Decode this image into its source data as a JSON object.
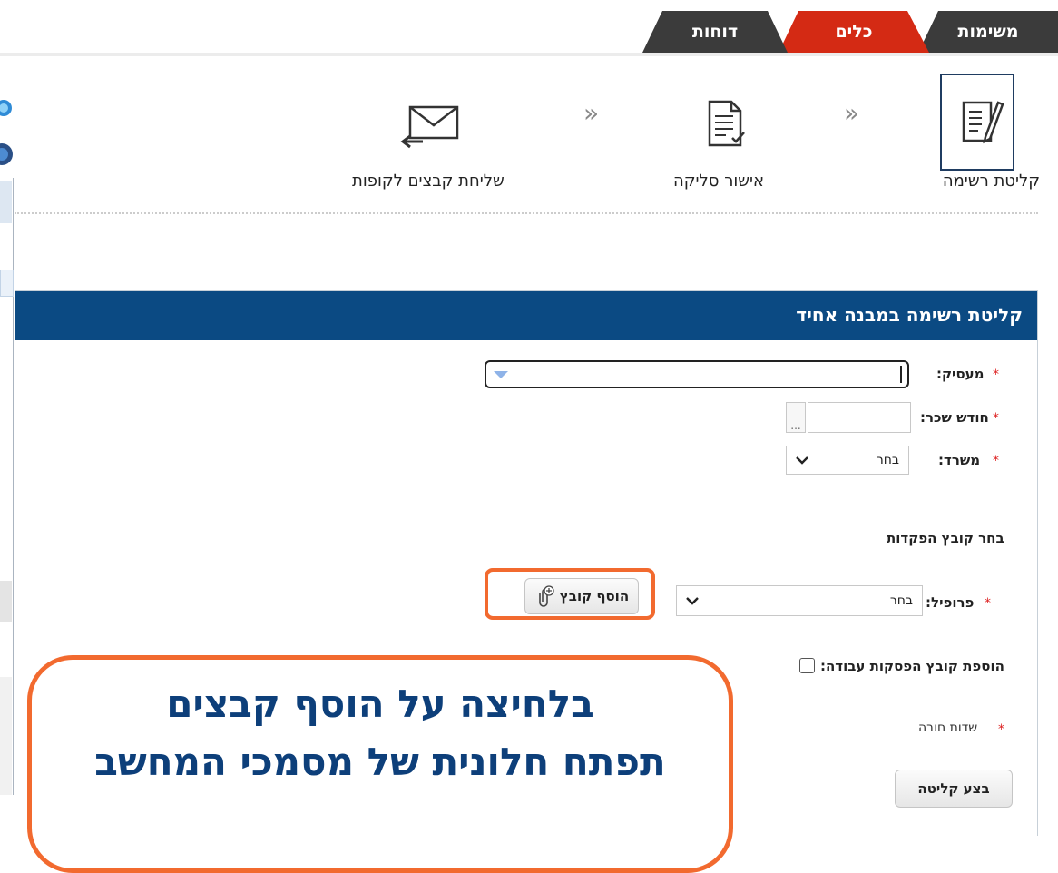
{
  "tabs": [
    {
      "label": "משימות",
      "color": "#3b3b3b"
    },
    {
      "label": "כלים",
      "color": "#d42a14"
    },
    {
      "label": "דוחות",
      "color": "#3b3b3b"
    }
  ],
  "steps": {
    "step1": "קליטת רשימה",
    "step2": "אישור סליקה",
    "step3": "שליחת קבצים לקופות",
    "separator": "«"
  },
  "panel": {
    "title": "קליטת רשימה במבנה אחיד",
    "required_mark": "*",
    "employer_label": "מעסיק:",
    "salary_month_label": "חודש שכר:",
    "salary_month_button": "...",
    "ministry_label": "משרד:",
    "ministry_value": "בחר",
    "select_file_link": "בחר קובץ הפקדות",
    "profile_label": "פרופיל:",
    "profile_value": "בחר",
    "add_file_button": "הוסף קובץ",
    "add_stop_file_label": "הוספת קובץ הפסקות עבודה:",
    "required_fields_note": "שדות חובה",
    "submit_button": "בצע קליטה"
  },
  "callout": {
    "line1": "בלחיצה על הוסף קבצים",
    "line2": "תפתח חלונית של מסמכי המחשב"
  },
  "colors": {
    "panel_header": "#0b4a83",
    "highlight": "#f26a2f",
    "callout_text": "#0d3f7a",
    "active_tab": "#d42a14"
  }
}
